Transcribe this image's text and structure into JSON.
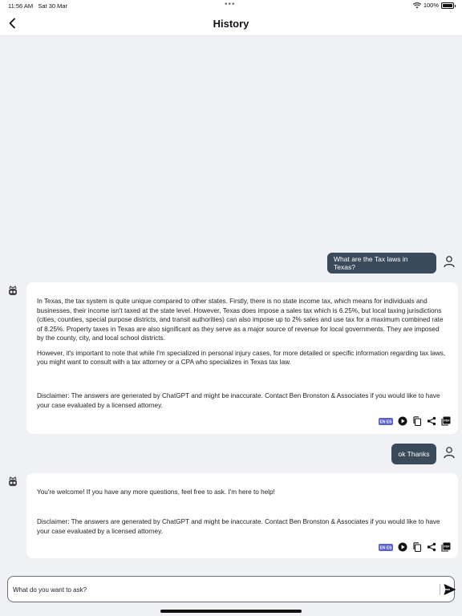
{
  "status_bar": {
    "time": "11:56 AM",
    "date": "Sat 30 Mar",
    "dots": "•••",
    "battery": "100%"
  },
  "nav": {
    "title": "History",
    "back_icon": "chevron-left-icon"
  },
  "messages": [
    {
      "role": "user",
      "text": "What are the Tax laws in Texas?"
    },
    {
      "role": "bot",
      "paragraphs": [
        "In Texas, the tax system is quite unique compared to other states. Firstly, there is no state income tax, which means for individuals and businesses, their income isn't taxed at the state level. However, Texas does impose a sales tax which is 6.25%, but local taxing jurisdictions (cities, counties, special purpose districts, and transit authorities) can also impose up to 2% sales and use tax for a maximum combined rate of 8.25%. Property taxes in Texas are also significant as they serve as a major source of revenue for local governments. They are imposed by the county, city, and local school districts.",
        "However, it's important to note that while I'm specialized in personal injury cases, for more detailed or specific information regarding tax laws, you might want to consult with a tax attorney or a CPA who specializes in Texas tax law."
      ],
      "disclaimer": "Disclaimer: The answers are generated by ChatGPT and might be inaccurate. Contact Ben Bronston & Associates if you would like to have your case evaluated by a licensed attorney."
    },
    {
      "role": "user",
      "text": "ok Thanks"
    },
    {
      "role": "bot",
      "paragraphs": [
        "You're welcome! If you have any more questions, feel free to ask. I'm here to help!"
      ],
      "disclaimer": "Disclaimer: The answers are generated by ChatGPT and might be inaccurate. Contact Ben Bronston & Associates if you would like to have your case evaluated by a licensed attorney."
    }
  ],
  "actions": {
    "translate_label": "EN ES",
    "icons": [
      "translate-icon",
      "play-icon",
      "copy-icon",
      "share-icon",
      "pdf-icon"
    ]
  },
  "input": {
    "placeholder": "What do you want to ask?",
    "send_icon": "send-icon"
  },
  "colors": {
    "user_bubble": "#3b4a5a",
    "background": "#f0f1f4",
    "card": "#ffffff",
    "translate_badge": "#5b5fc7"
  }
}
